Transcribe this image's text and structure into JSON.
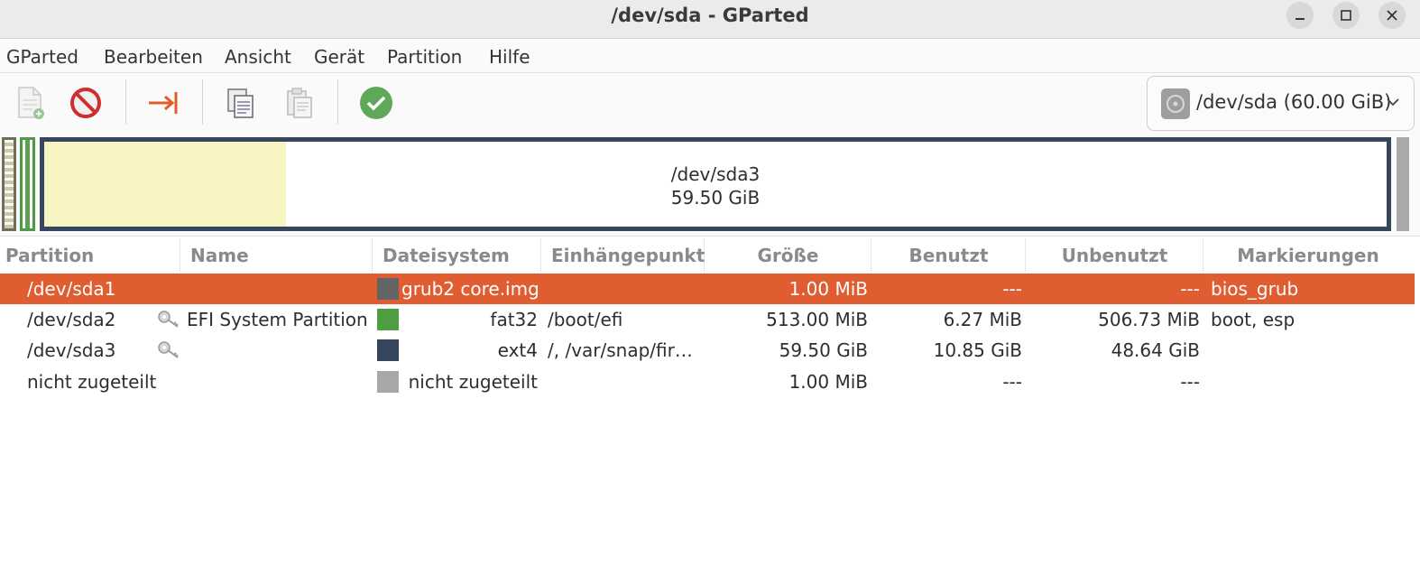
{
  "window": {
    "title": "/dev/sda - GParted",
    "buttons": [
      "minimize",
      "maximize",
      "close"
    ]
  },
  "menu": [
    "GParted",
    "Bearbeiten",
    "Ansicht",
    "Gerät",
    "Partition",
    "Hilfe"
  ],
  "toolbar": {
    "icons": [
      "new-partition-icon",
      "delete-partition-icon",
      "resize-move-icon",
      "copy-icon",
      "paste-icon",
      "apply-icon"
    ],
    "device_selector": "/dev/sda (60.00 GiB)"
  },
  "disk_map": {
    "selected_name": "/dev/sda3",
    "selected_size": "59.50 GiB",
    "used_fraction_sda3": 0.18
  },
  "table": {
    "headers": [
      "Partition",
      "Name",
      "Dateisystem",
      "Einhängepunkt",
      "Größe",
      "Benutzt",
      "Unbenutzt",
      "Markierungen"
    ],
    "rows": [
      {
        "partition": "/dev/sda1",
        "name": "",
        "filesystem": "grub2 core.img",
        "mount": "",
        "size": "1.00 MiB",
        "used": "---",
        "unused": "---",
        "flags": "bios_grub",
        "color": "#646464",
        "locked": false,
        "selected": true
      },
      {
        "partition": "/dev/sda2",
        "name": "EFI System Partition",
        "filesystem": "fat32",
        "mount": "/boot/efi",
        "size": "513.00 MiB",
        "used": "6.27 MiB",
        "unused": "506.73 MiB",
        "flags": "boot, esp",
        "color": "#4f9e43",
        "locked": true,
        "selected": false
      },
      {
        "partition": "/dev/sda3",
        "name": "",
        "filesystem": "ext4",
        "mount": "/, /var/snap/fir…",
        "size": "59.50 GiB",
        "used": "10.85 GiB",
        "unused": "48.64 GiB",
        "flags": "",
        "color": "#36465e",
        "locked": true,
        "selected": false
      },
      {
        "partition": "nicht zugeteilt",
        "name": "",
        "filesystem": "nicht zugeteilt",
        "mount": "",
        "size": "1.00 MiB",
        "used": "---",
        "unused": "---",
        "flags": "",
        "color": "#a7a7a7",
        "locked": false,
        "selected": false
      }
    ]
  },
  "colors": {
    "selection": "#e05c31",
    "ext4": "#36465e",
    "fat32": "#4f9e43",
    "used_space": "#f8f4c1"
  }
}
